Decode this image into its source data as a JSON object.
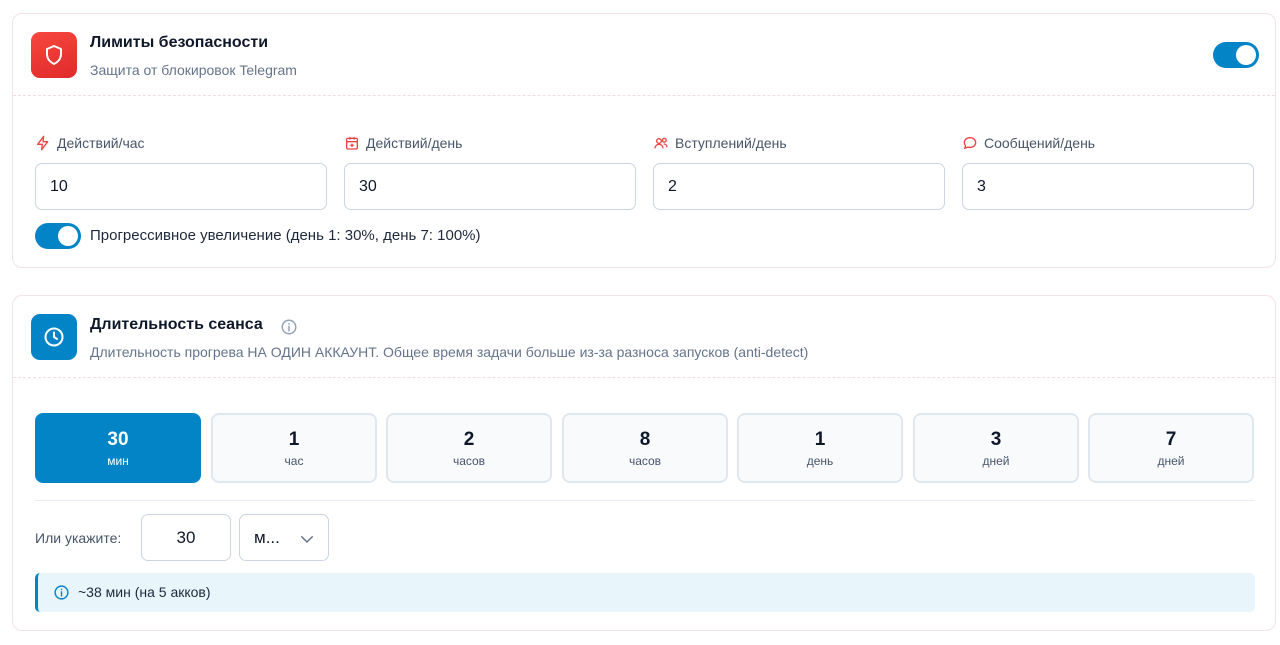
{
  "colors": {
    "accent": "#0284c7",
    "danger": "#ef4444",
    "note_bg": "#e8f5fb"
  },
  "limits": {
    "icon": "shield-icon",
    "title": "Лимиты безопасности",
    "subtitle": "Защита от блокировок Telegram",
    "enabled": true,
    "fields": [
      {
        "icon": "lightning-icon",
        "label": "Действий/час",
        "value": "10"
      },
      {
        "icon": "calendar-icon",
        "label": "Действий/день",
        "value": "30"
      },
      {
        "icon": "users-icon",
        "label": "Вступлений/день",
        "value": "2"
      },
      {
        "icon": "message-icon",
        "label": "Сообщений/день",
        "value": "3"
      }
    ],
    "progressive": {
      "enabled": true,
      "label": "Прогрессивное увеличение (день 1: 30%, день 7: 100%)"
    }
  },
  "session": {
    "icon": "clock-icon",
    "title": "Длительность сеанса",
    "subtitle": "Длительность прогрева НА ОДИН АККАУНТ. Общее время задачи больше из-за разноса запусков (anti-detect)",
    "presets": [
      {
        "num": "30",
        "unit": "мин",
        "active": true
      },
      {
        "num": "1",
        "unit": "час",
        "active": false
      },
      {
        "num": "2",
        "unit": "часов",
        "active": false
      },
      {
        "num": "8",
        "unit": "часов",
        "active": false
      },
      {
        "num": "1",
        "unit": "день",
        "active": false
      },
      {
        "num": "3",
        "unit": "дней",
        "active": false
      },
      {
        "num": "7",
        "unit": "дней",
        "active": false
      }
    ],
    "custom_label": "Или укажите:",
    "custom_value": "30",
    "unit_select": "м...",
    "note": "~38 мин (на 5 акков)"
  }
}
